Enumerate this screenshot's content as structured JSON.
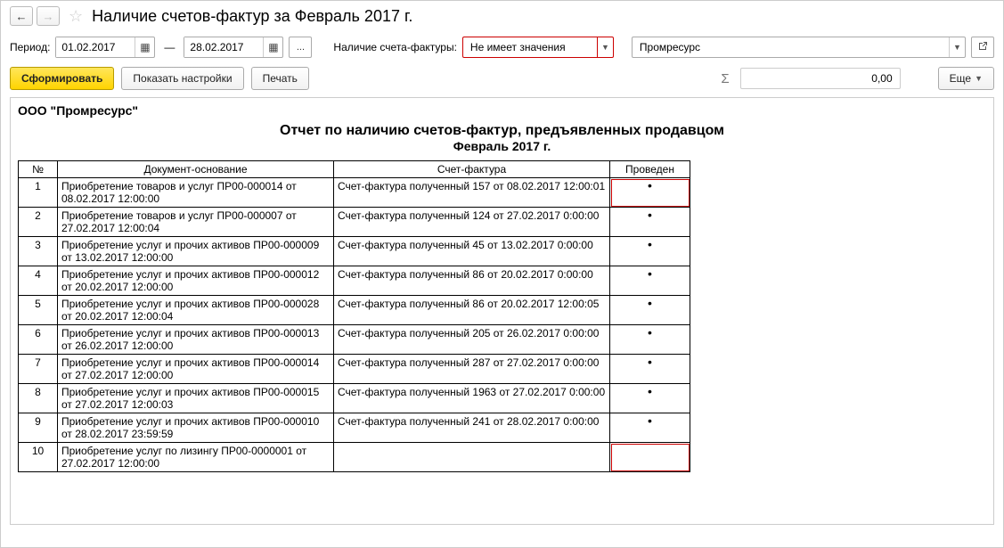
{
  "header": {
    "title": "Наличие счетов-фактур за Февраль 2017 г."
  },
  "filters": {
    "period_label": "Период:",
    "date_from": "01.02.2017",
    "date_to": "28.02.2017",
    "ellipsis": "...",
    "invoice_presence_label": "Наличие счета-фактуры:",
    "invoice_presence_value": "Не имеет значения",
    "org_value": "Промресурс"
  },
  "actions": {
    "generate": "Сформировать",
    "show_settings": "Показать настройки",
    "print": "Печать",
    "sum_value": "0,00",
    "more": "Еще"
  },
  "report": {
    "org_title": "ООО \"Промресурс\"",
    "title": "Отчет по наличию счетов-фактур, предъявленных продавцом",
    "subtitle": "Февраль 2017 г.",
    "columns": {
      "num": "№",
      "doc": "Документ-основание",
      "invoice": "Счет-фактура",
      "posted": "Проведен"
    },
    "rows": [
      {
        "num": "1",
        "doc": "Приобретение товаров и услуг ПР00-000014 от 08.02.2017 12:00:00",
        "invoice": "Счет-фактура полученный 157 от 08.02.2017 12:00:01",
        "posted": "•",
        "hl": true
      },
      {
        "num": "2",
        "doc": "Приобретение товаров и услуг ПР00-000007 от 27.02.2017 12:00:04",
        "invoice": "Счет-фактура полученный 124 от 27.02.2017 0:00:00",
        "posted": "•",
        "hl": false
      },
      {
        "num": "3",
        "doc": "Приобретение услуг и прочих активов ПР00-000009 от 13.02.2017 12:00:00",
        "invoice": "Счет-фактура полученный 45 от 13.02.2017 0:00:00",
        "posted": "•",
        "hl": false
      },
      {
        "num": "4",
        "doc": "Приобретение услуг и прочих активов ПР00-000012 от 20.02.2017 12:00:00",
        "invoice": "Счет-фактура полученный 86 от 20.02.2017 0:00:00",
        "posted": "•",
        "hl": false
      },
      {
        "num": "5",
        "doc": "Приобретение услуг и прочих активов ПР00-000028 от 20.02.2017 12:00:04",
        "invoice": "Счет-фактура полученный 86 от 20.02.2017 12:00:05",
        "posted": "•",
        "hl": false
      },
      {
        "num": "6",
        "doc": "Приобретение услуг и прочих активов ПР00-000013 от 26.02.2017 12:00:00",
        "invoice": "Счет-фактура полученный 205 от 26.02.2017 0:00:00",
        "posted": "•",
        "hl": false
      },
      {
        "num": "7",
        "doc": "Приобретение услуг и прочих активов ПР00-000014 от 27.02.2017 12:00:00",
        "invoice": "Счет-фактура полученный 287 от 27.02.2017 0:00:00",
        "posted": "•",
        "hl": false
      },
      {
        "num": "8",
        "doc": "Приобретение услуг и прочих активов ПР00-000015 от 27.02.2017 12:00:03",
        "invoice": "Счет-фактура полученный 1963 от 27.02.2017 0:00:00",
        "posted": "•",
        "hl": false
      },
      {
        "num": "9",
        "doc": "Приобретение услуг и прочих активов ПР00-000010 от 28.02.2017 23:59:59",
        "invoice": "Счет-фактура полученный 241 от 28.02.2017 0:00:00",
        "posted": "•",
        "hl": false
      },
      {
        "num": "10",
        "doc": "Приобретение услуг по лизингу ПР00-0000001 от 27.02.2017 12:00:00",
        "invoice": "",
        "posted": "",
        "hl": true
      }
    ]
  }
}
